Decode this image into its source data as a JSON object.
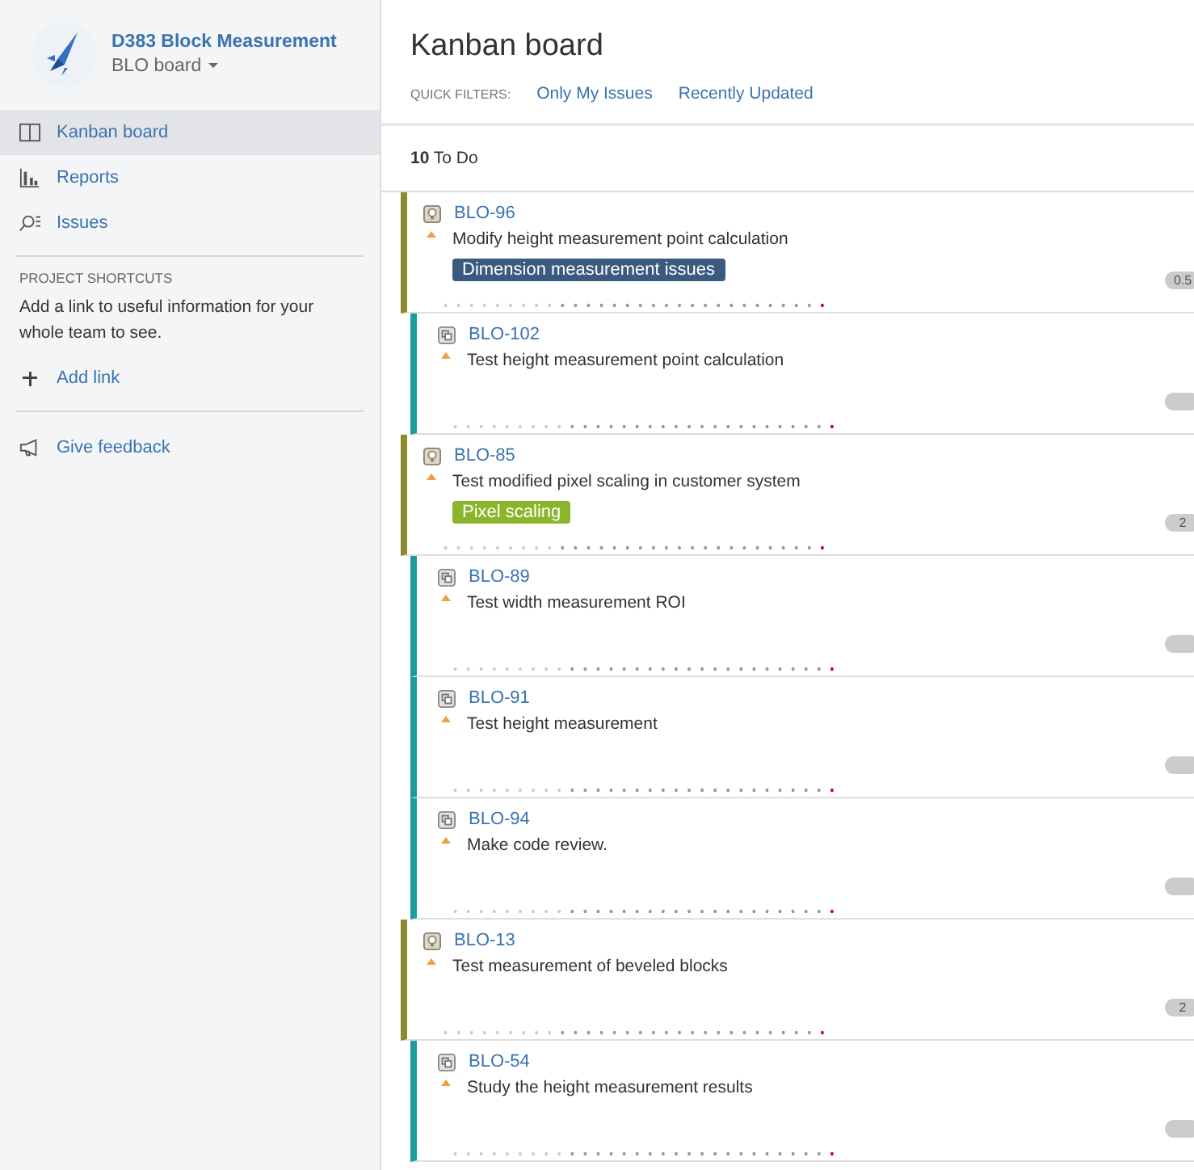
{
  "project": {
    "name": "D383 Block Measurement",
    "board": "BLO board"
  },
  "sidebar": {
    "items": [
      {
        "label": "Kanban board",
        "selected": true
      },
      {
        "label": "Reports",
        "selected": false
      },
      {
        "label": "Issues",
        "selected": false
      }
    ],
    "shortcuts_heading": "PROJECT SHORTCUTS",
    "shortcuts_text": "Add a link to useful information for your whole team to see.",
    "add_link": "Add link",
    "feedback": "Give feedback"
  },
  "title": "Kanban board",
  "quick_filters": {
    "label": "QUICK FILTERS:",
    "filters": [
      "Only My Issues",
      "Recently Updated"
    ]
  },
  "column": {
    "count": "10",
    "name": "To Do"
  },
  "cards": [
    {
      "kind": "story",
      "key": "BLO-96",
      "summary": "Modify height measurement point calculation",
      "epic": {
        "label": "Dimension measurement issues",
        "color": "#3b5a7f"
      },
      "estimate": "0.5"
    },
    {
      "kind": "subtask",
      "key": "BLO-102",
      "summary": "Test height measurement point calculation"
    },
    {
      "kind": "story",
      "key": "BLO-85",
      "summary": "Test modified pixel scaling in customer system",
      "epic": {
        "label": "Pixel scaling",
        "color": "#8bb52a"
      },
      "estimate": "2"
    },
    {
      "kind": "subtask",
      "key": "BLO-89",
      "summary": "Test width measurement ROI"
    },
    {
      "kind": "subtask",
      "key": "BLO-91",
      "summary": "Test height measurement"
    },
    {
      "kind": "subtask",
      "key": "BLO-94",
      "summary": "Make code review."
    },
    {
      "kind": "story",
      "key": "BLO-13",
      "summary": "Test measurement of beveled blocks",
      "estimate": "2"
    },
    {
      "kind": "subtask",
      "key": "BLO-54",
      "summary": "Study the height measurement results"
    }
  ]
}
